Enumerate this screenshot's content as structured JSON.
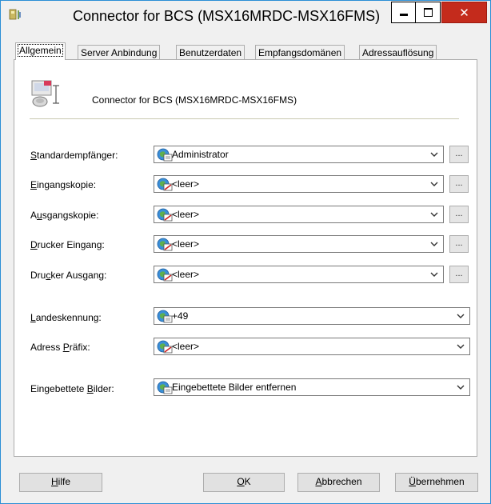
{
  "window": {
    "title": "Connector for BCS (MSX16MRDC-MSX16FMS)"
  },
  "tabs": [
    {
      "label": "Allgemein",
      "active": true
    },
    {
      "label": "Server Anbindung",
      "active": false
    },
    {
      "label": "Benutzerdaten",
      "active": false
    },
    {
      "label": "Empfangsdomänen",
      "active": false
    },
    {
      "label": "Adressauflösung",
      "active": false
    }
  ],
  "header": {
    "text": "Connector for BCS (MSX16MRDC-MSX16FMS)"
  },
  "fields": [
    {
      "label_pre": "",
      "label_acc": "S",
      "label_post": "tandardempfänger:",
      "value": "Administrator",
      "icon": "contact-icon"
    },
    {
      "label_pre": "",
      "label_acc": "E",
      "label_post": "ingangskopie:",
      "value": "<leer>",
      "icon": "empty-contact-icon"
    },
    {
      "label_pre": "A",
      "label_acc": "u",
      "label_post": "sgangskopie:",
      "value": "<leer>",
      "icon": "empty-contact-icon"
    },
    {
      "label_pre": "",
      "label_acc": "D",
      "label_post": "rucker Eingang:",
      "value": "<leer>",
      "icon": "empty-contact-icon"
    },
    {
      "label_pre": "Dru",
      "label_acc": "c",
      "label_post": "ker Ausgang:",
      "value": "<leer>",
      "icon": "empty-contact-icon"
    },
    {
      "label_pre": "",
      "label_acc": "L",
      "label_post": "andeskennung:",
      "value": "+49",
      "icon": "contact-icon"
    },
    {
      "label_pre": "Adress ",
      "label_acc": "P",
      "label_post": "räfix:",
      "value": "<leer>",
      "icon": "empty-contact-icon"
    },
    {
      "label_pre": "Eingebettete ",
      "label_acc": "B",
      "label_post": "ilder:",
      "value": "Eingebettete Bilder entfernen",
      "icon": "contact-icon"
    }
  ],
  "browse_label": "...",
  "buttons": {
    "help": {
      "pre": "",
      "acc": "H",
      "post": "ilfe"
    },
    "ok": {
      "pre": "",
      "acc": "O",
      "post": "K"
    },
    "cancel": {
      "pre": "",
      "acc": "A",
      "post": "bbrechen"
    },
    "apply": {
      "pre": "",
      "acc": "Ü",
      "post": "bernehmen"
    }
  },
  "colors": {
    "close_button": "#c42b1c",
    "window_border": "#2b8fd6"
  }
}
